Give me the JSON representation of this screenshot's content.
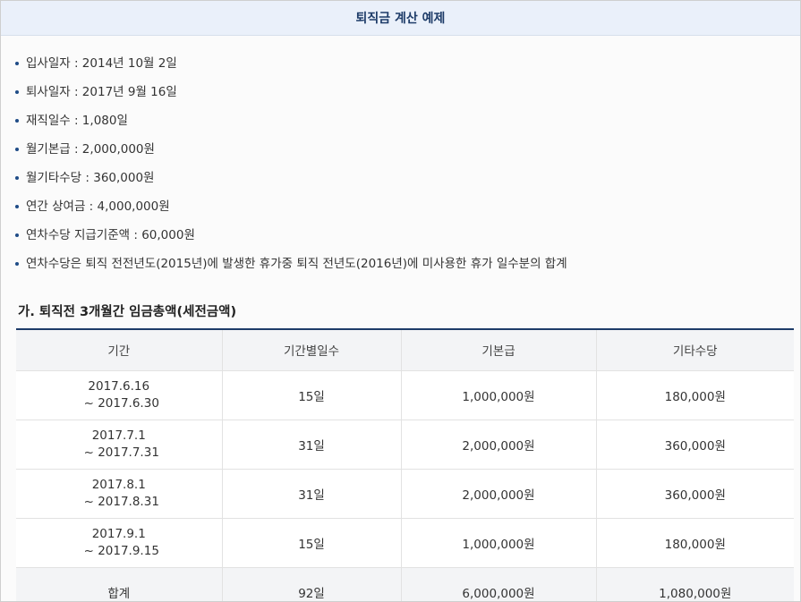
{
  "header": {
    "title": "퇴직금 계산 예제"
  },
  "info_items": [
    "입사일자 : 2014년 10월 2일",
    "퇴사일자 : 2017년 9월 16일",
    "재직일수 : 1,080일",
    "월기본급 : 2,000,000원",
    "월기타수당 : 360,000원",
    "연간 상여금 : 4,000,000원",
    "연차수당 지급기준액 : 60,000원",
    "연차수당은 퇴직 전전년도(2015년)에 발생한 휴가중 퇴직 전년도(2016년)에 미사용한 휴가 일수분의 합계"
  ],
  "section": {
    "title": "가. 퇴직전 3개월간 임금총액(세전금액)"
  },
  "table": {
    "headers": [
      "기간",
      "기간별일수",
      "기본급",
      "기타수당"
    ],
    "rows": [
      {
        "period_start": "2017.6.16",
        "period_end": "~ 2017.6.30",
        "days": "15일",
        "base": "1,000,000원",
        "other": "180,000원"
      },
      {
        "period_start": "2017.7.1",
        "period_end": "~ 2017.7.31",
        "days": "31일",
        "base": "2,000,000원",
        "other": "360,000원"
      },
      {
        "period_start": "2017.8.1",
        "period_end": "~ 2017.8.31",
        "days": "31일",
        "base": "2,000,000원",
        "other": "360,000원"
      },
      {
        "period_start": "2017.9.1",
        "period_end": "~ 2017.9.15",
        "days": "15일",
        "base": "1,000,000원",
        "other": "180,000원"
      }
    ],
    "total": {
      "label": "합계",
      "days": "92일",
      "base": "6,000,000원",
      "other": "1,080,000원"
    }
  },
  "colors": {
    "header_bg": "#eaf0fa",
    "accent": "#1d3b68",
    "bullet": "#1f4c87"
  }
}
